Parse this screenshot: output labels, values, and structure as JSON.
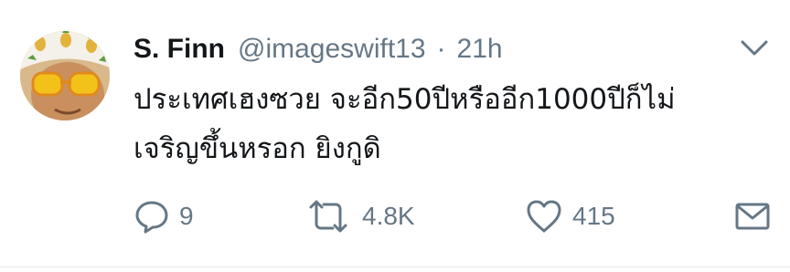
{
  "tweet": {
    "display_name": "S. Finn",
    "handle": "@imageswift13",
    "separator": "·",
    "time": "21h",
    "text_lines": [
      "ประเทศเฮงซวย จะอีก50ปีหรืออีก1000ปีก็ไม่",
      "เจริญขึ้นหรอก ยิงกูดิ"
    ],
    "menu_icon": "chevron-down-icon"
  },
  "actions": {
    "reply": {
      "icon": "reply-icon",
      "count": "9"
    },
    "retweet": {
      "icon": "retweet-icon",
      "count": "4.8K"
    },
    "like": {
      "icon": "heart-icon",
      "count": "415"
    },
    "dm": {
      "icon": "envelope-icon"
    }
  },
  "colors": {
    "text": "#14171a",
    "secondary": "#657786",
    "background": "#ffffff"
  }
}
